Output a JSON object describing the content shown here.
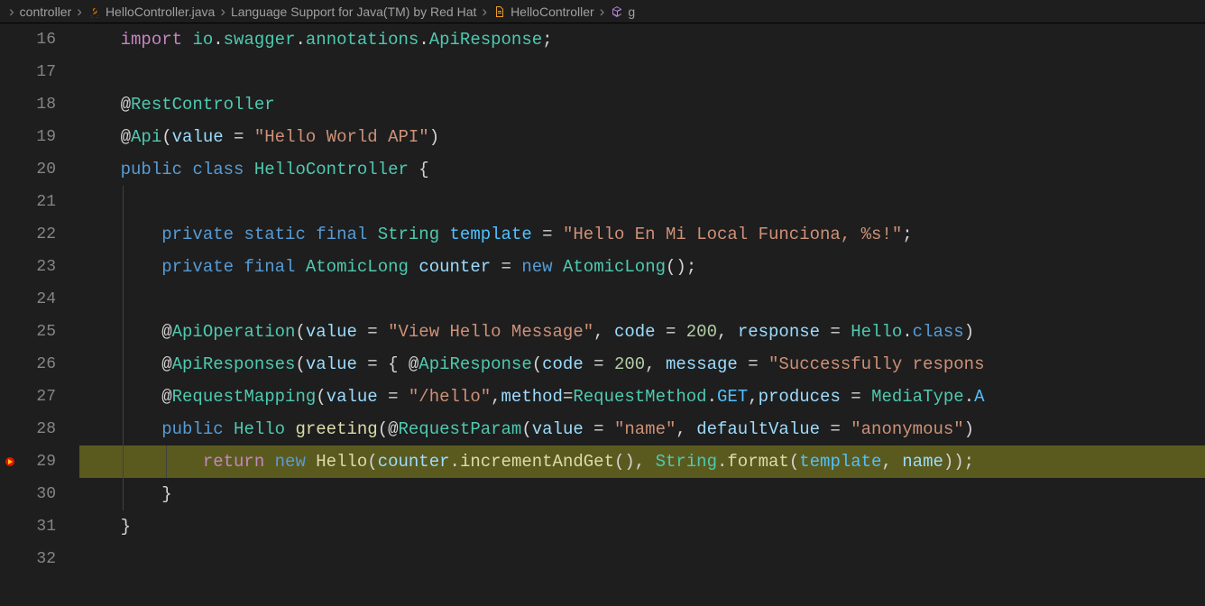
{
  "breadcrumb": {
    "items": [
      {
        "label": "controller",
        "icon": null
      },
      {
        "label": "HelloController.java",
        "icon": "java"
      },
      {
        "label": "Language Support for Java(TM) by Red Hat",
        "icon": null
      },
      {
        "label": "HelloController",
        "icon": "class"
      },
      {
        "label": "g",
        "icon": "method"
      }
    ]
  },
  "editor": {
    "lines": [
      {
        "num": "16",
        "breakpoint": false,
        "highlighted": false,
        "indent": 0,
        "tokens": [
          {
            "t": "    ",
            "c": "plain"
          },
          {
            "t": "import",
            "c": "purple"
          },
          {
            "t": " ",
            "c": "plain"
          },
          {
            "t": "io",
            "c": "type"
          },
          {
            "t": ".",
            "c": "plain"
          },
          {
            "t": "swagger",
            "c": "type"
          },
          {
            "t": ".",
            "c": "plain"
          },
          {
            "t": "annotations",
            "c": "type"
          },
          {
            "t": ".",
            "c": "plain"
          },
          {
            "t": "ApiResponse",
            "c": "type"
          },
          {
            "t": ";",
            "c": "plain"
          }
        ]
      },
      {
        "num": "17",
        "breakpoint": false,
        "highlighted": false,
        "indent": 0,
        "tokens": []
      },
      {
        "num": "18",
        "breakpoint": false,
        "highlighted": false,
        "indent": 0,
        "tokens": [
          {
            "t": "    ",
            "c": "plain"
          },
          {
            "t": "@",
            "c": "decorator-at"
          },
          {
            "t": "RestController",
            "c": "decorator"
          }
        ]
      },
      {
        "num": "19",
        "breakpoint": false,
        "highlighted": false,
        "indent": 0,
        "tokens": [
          {
            "t": "    ",
            "c": "plain"
          },
          {
            "t": "@",
            "c": "decorator-at"
          },
          {
            "t": "Api",
            "c": "decorator"
          },
          {
            "t": "(",
            "c": "plain"
          },
          {
            "t": "value",
            "c": "var"
          },
          {
            "t": " = ",
            "c": "plain"
          },
          {
            "t": "\"Hello World API\"",
            "c": "string"
          },
          {
            "t": ")",
            "c": "plain"
          }
        ]
      },
      {
        "num": "20",
        "breakpoint": false,
        "highlighted": false,
        "indent": 0,
        "tokens": [
          {
            "t": "    ",
            "c": "plain"
          },
          {
            "t": "public",
            "c": "keyword"
          },
          {
            "t": " ",
            "c": "plain"
          },
          {
            "t": "class",
            "c": "keyword"
          },
          {
            "t": " ",
            "c": "plain"
          },
          {
            "t": "HelloController",
            "c": "type"
          },
          {
            "t": " {",
            "c": "plain"
          }
        ]
      },
      {
        "num": "21",
        "breakpoint": false,
        "highlighted": false,
        "indent": 1,
        "tokens": []
      },
      {
        "num": "22",
        "breakpoint": false,
        "highlighted": false,
        "indent": 1,
        "tokens": [
          {
            "t": "        ",
            "c": "plain"
          },
          {
            "t": "private",
            "c": "keyword"
          },
          {
            "t": " ",
            "c": "plain"
          },
          {
            "t": "static",
            "c": "keyword"
          },
          {
            "t": " ",
            "c": "plain"
          },
          {
            "t": "final",
            "c": "keyword"
          },
          {
            "t": " ",
            "c": "plain"
          },
          {
            "t": "String",
            "c": "type"
          },
          {
            "t": " ",
            "c": "plain"
          },
          {
            "t": "template",
            "c": "const"
          },
          {
            "t": " = ",
            "c": "plain"
          },
          {
            "t": "\"Hello En Mi Local Funciona, %s!\"",
            "c": "string"
          },
          {
            "t": ";",
            "c": "plain"
          }
        ]
      },
      {
        "num": "23",
        "breakpoint": false,
        "highlighted": false,
        "indent": 1,
        "tokens": [
          {
            "t": "        ",
            "c": "plain"
          },
          {
            "t": "private",
            "c": "keyword"
          },
          {
            "t": " ",
            "c": "plain"
          },
          {
            "t": "final",
            "c": "keyword"
          },
          {
            "t": " ",
            "c": "plain"
          },
          {
            "t": "AtomicLong",
            "c": "type"
          },
          {
            "t": " ",
            "c": "plain"
          },
          {
            "t": "counter",
            "c": "var"
          },
          {
            "t": " = ",
            "c": "plain"
          },
          {
            "t": "new",
            "c": "keyword"
          },
          {
            "t": " ",
            "c": "plain"
          },
          {
            "t": "AtomicLong",
            "c": "type"
          },
          {
            "t": "();",
            "c": "plain"
          }
        ]
      },
      {
        "num": "24",
        "breakpoint": false,
        "highlighted": false,
        "indent": 1,
        "tokens": []
      },
      {
        "num": "25",
        "breakpoint": false,
        "highlighted": false,
        "indent": 1,
        "tokens": [
          {
            "t": "        ",
            "c": "plain"
          },
          {
            "t": "@",
            "c": "decorator-at"
          },
          {
            "t": "ApiOperation",
            "c": "decorator"
          },
          {
            "t": "(",
            "c": "plain"
          },
          {
            "t": "value",
            "c": "var"
          },
          {
            "t": " = ",
            "c": "plain"
          },
          {
            "t": "\"View Hello Message\"",
            "c": "string"
          },
          {
            "t": ", ",
            "c": "plain"
          },
          {
            "t": "code",
            "c": "var"
          },
          {
            "t": " = ",
            "c": "plain"
          },
          {
            "t": "200",
            "c": "num"
          },
          {
            "t": ", ",
            "c": "plain"
          },
          {
            "t": "response",
            "c": "var"
          },
          {
            "t": " = ",
            "c": "plain"
          },
          {
            "t": "Hello",
            "c": "type"
          },
          {
            "t": ".",
            "c": "plain"
          },
          {
            "t": "class",
            "c": "keyword"
          },
          {
            "t": ")",
            "c": "plain"
          }
        ]
      },
      {
        "num": "26",
        "breakpoint": false,
        "highlighted": false,
        "indent": 1,
        "tokens": [
          {
            "t": "        ",
            "c": "plain"
          },
          {
            "t": "@",
            "c": "decorator-at"
          },
          {
            "t": "ApiResponses",
            "c": "decorator"
          },
          {
            "t": "(",
            "c": "plain"
          },
          {
            "t": "value",
            "c": "var"
          },
          {
            "t": " = { ",
            "c": "plain"
          },
          {
            "t": "@",
            "c": "decorator-at"
          },
          {
            "t": "ApiResponse",
            "c": "decorator"
          },
          {
            "t": "(",
            "c": "plain"
          },
          {
            "t": "code",
            "c": "var"
          },
          {
            "t": " = ",
            "c": "plain"
          },
          {
            "t": "200",
            "c": "num"
          },
          {
            "t": ", ",
            "c": "plain"
          },
          {
            "t": "message",
            "c": "var"
          },
          {
            "t": " = ",
            "c": "plain"
          },
          {
            "t": "\"Successfully respons",
            "c": "string"
          }
        ]
      },
      {
        "num": "27",
        "breakpoint": false,
        "highlighted": false,
        "indent": 1,
        "tokens": [
          {
            "t": "        ",
            "c": "plain"
          },
          {
            "t": "@",
            "c": "decorator-at"
          },
          {
            "t": "RequestMapping",
            "c": "decorator"
          },
          {
            "t": "(",
            "c": "plain"
          },
          {
            "t": "value",
            "c": "var"
          },
          {
            "t": " = ",
            "c": "plain"
          },
          {
            "t": "\"/hello\"",
            "c": "string"
          },
          {
            "t": ",",
            "c": "plain"
          },
          {
            "t": "method",
            "c": "var"
          },
          {
            "t": "=",
            "c": "plain"
          },
          {
            "t": "RequestMethod",
            "c": "type"
          },
          {
            "t": ".",
            "c": "plain"
          },
          {
            "t": "GET",
            "c": "const"
          },
          {
            "t": ",",
            "c": "plain"
          },
          {
            "t": "produces",
            "c": "var"
          },
          {
            "t": " = ",
            "c": "plain"
          },
          {
            "t": "MediaType",
            "c": "type"
          },
          {
            "t": ".",
            "c": "plain"
          },
          {
            "t": "A",
            "c": "const"
          }
        ]
      },
      {
        "num": "28",
        "breakpoint": false,
        "highlighted": false,
        "indent": 1,
        "tokens": [
          {
            "t": "        ",
            "c": "plain"
          },
          {
            "t": "public",
            "c": "keyword"
          },
          {
            "t": " ",
            "c": "plain"
          },
          {
            "t": "Hello",
            "c": "type"
          },
          {
            "t": " ",
            "c": "plain"
          },
          {
            "t": "greeting",
            "c": "method"
          },
          {
            "t": "(",
            "c": "plain"
          },
          {
            "t": "@",
            "c": "decorator-at"
          },
          {
            "t": "RequestParam",
            "c": "decorator"
          },
          {
            "t": "(",
            "c": "plain"
          },
          {
            "t": "value",
            "c": "var"
          },
          {
            "t": " = ",
            "c": "plain"
          },
          {
            "t": "\"name\"",
            "c": "string"
          },
          {
            "t": ", ",
            "c": "plain"
          },
          {
            "t": "defaultValue",
            "c": "var"
          },
          {
            "t": " = ",
            "c": "plain"
          },
          {
            "t": "\"anonymous\"",
            "c": "string"
          },
          {
            "t": ") ",
            "c": "plain"
          }
        ]
      },
      {
        "num": "29",
        "breakpoint": true,
        "highlighted": true,
        "indent": 2,
        "tokens": [
          {
            "t": "            ",
            "c": "plain"
          },
          {
            "t": "return",
            "c": "purple"
          },
          {
            "t": " ",
            "c": "plain"
          },
          {
            "t": "new",
            "c": "keyword"
          },
          {
            "t": " ",
            "c": "plain"
          },
          {
            "t": "Hello",
            "c": "method"
          },
          {
            "t": "(",
            "c": "plain"
          },
          {
            "t": "counter",
            "c": "var"
          },
          {
            "t": ".",
            "c": "plain"
          },
          {
            "t": "incrementAndGet",
            "c": "method"
          },
          {
            "t": "(), ",
            "c": "plain"
          },
          {
            "t": "String",
            "c": "type"
          },
          {
            "t": ".",
            "c": "plain"
          },
          {
            "t": "format",
            "c": "method"
          },
          {
            "t": "(",
            "c": "plain"
          },
          {
            "t": "template",
            "c": "const"
          },
          {
            "t": ", ",
            "c": "plain"
          },
          {
            "t": "name",
            "c": "var"
          },
          {
            "t": "));",
            "c": "plain"
          }
        ]
      },
      {
        "num": "30",
        "breakpoint": false,
        "highlighted": false,
        "indent": 1,
        "tokens": [
          {
            "t": "        }",
            "c": "plain"
          }
        ]
      },
      {
        "num": "31",
        "breakpoint": false,
        "highlighted": false,
        "indent": 0,
        "tokens": [
          {
            "t": "    }",
            "c": "plain"
          }
        ]
      },
      {
        "num": "32",
        "breakpoint": false,
        "highlighted": false,
        "indent": 0,
        "tokens": []
      }
    ]
  }
}
